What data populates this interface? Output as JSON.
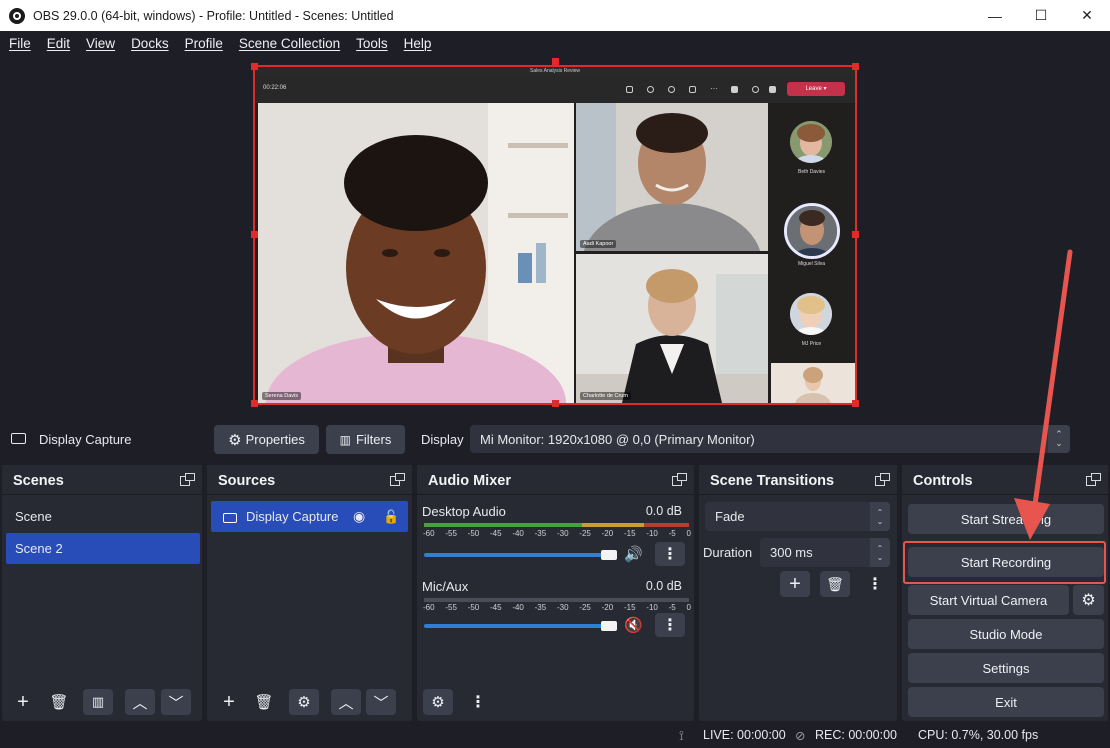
{
  "window": {
    "title": "OBS 29.0.0 (64-bit, windows) - Profile: Untitled - Scenes: Untitled",
    "minimize": "—",
    "maximize": "☐",
    "close": "✕"
  },
  "menu": [
    "File",
    "Edit",
    "View",
    "Docks",
    "Profile",
    "Scene Collection",
    "Tools",
    "Help"
  ],
  "preview": {
    "meeting_title": "Sales Analysis Review",
    "timer": "00:22:06",
    "leave_label": "Leave",
    "participants": {
      "main": "Serena Davis",
      "top_right": "Aadi Kapoor",
      "bottom_right": "Charlotte de Crum",
      "side": [
        "Beth Davies",
        "Miguel Silva",
        "MJ Price"
      ]
    }
  },
  "source_toolbar": {
    "source_name": "Display Capture",
    "properties_label": "Properties",
    "filters_label": "Filters",
    "display_label": "Display",
    "display_value": "Mi Monitor: 1920x1080 @ 0,0 (Primary Monitor)"
  },
  "scenes": {
    "title": "Scenes",
    "items": [
      "Scene",
      "Scene 2"
    ],
    "selected": "Scene 2"
  },
  "sources": {
    "title": "Sources",
    "items": [
      {
        "name": "Display Capture",
        "visible": true,
        "locked": false
      }
    ]
  },
  "mixer": {
    "title": "Audio Mixer",
    "tracks": [
      {
        "name": "Desktop Audio",
        "db": "0.0 dB",
        "volume": 1.0,
        "muted": false
      },
      {
        "name": "Mic/Aux",
        "db": "0.0 dB",
        "volume": 1.0,
        "muted": true
      }
    ],
    "ticks": [
      "-60",
      "-55",
      "-50",
      "-45",
      "-40",
      "-35",
      "-30",
      "-25",
      "-20",
      "-15",
      "-10",
      "-5",
      "0"
    ]
  },
  "transitions": {
    "title": "Scene Transitions",
    "selected": "Fade",
    "duration_label": "Duration",
    "duration_value": "300 ms"
  },
  "controls": {
    "title": "Controls",
    "start_streaming": "Start Streaming",
    "start_recording": "Start Recording",
    "start_virtual_camera": "Start Virtual Camera",
    "studio_mode": "Studio Mode",
    "settings": "Settings",
    "exit": "Exit"
  },
  "status": {
    "live": "LIVE: 00:00:00",
    "rec": "REC: 00:00:00",
    "cpu": "CPU: 0.7%, 30.00 fps"
  },
  "colors": {
    "accent": "#284cb8",
    "selection": "#e02b2b",
    "annotation": "#e8554e"
  }
}
